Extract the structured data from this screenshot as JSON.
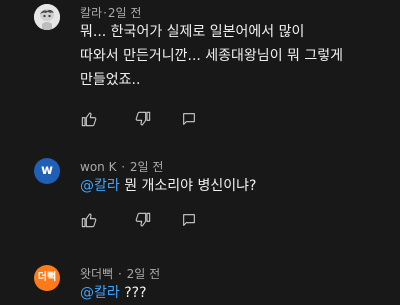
{
  "comments": [
    {
      "author": "칼라",
      "time": "2일 전",
      "lines": [
        "뭐... 한국어가 실제로 일본어에서 많이",
        "따와서 만든거니깐... 세종대왕님이 뭐 그렇게",
        "만들었죠.."
      ]
    },
    {
      "author": "won K",
      "avatar_letter": "w",
      "time": "2일 전",
      "mention": "@칼라",
      "text": " 뭔 개소리야 병신이냐?"
    },
    {
      "author": "왓더뻑",
      "avatar_label": "더뻑",
      "time": "2일 전",
      "mention": "@칼라",
      "text": " ???"
    }
  ],
  "icons": {
    "like": "thumb-up-icon",
    "dislike": "thumb-down-icon",
    "reply": "reply-icon"
  },
  "colors": {
    "background": "#181818",
    "mention": "#3ea6ff",
    "meta": "#aaaaaa",
    "avatar_w": "#1f5fb5",
    "avatar_kr": "#ff7a1a"
  }
}
